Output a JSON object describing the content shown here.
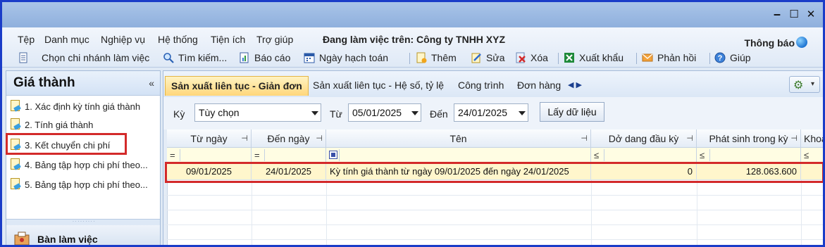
{
  "window": {
    "buttons": {
      "minimize": "‒",
      "maximize": "☐",
      "close": "✕"
    }
  },
  "menubar": {
    "items": [
      "Tệp",
      "Danh mục",
      "Nghiệp vụ",
      "Hệ thống",
      "Tiện ích",
      "Trợ giúp"
    ],
    "working_label": "Đang làm việc trên:  Công ty TNHH XYZ",
    "notification": "Thông báo"
  },
  "toolbar": {
    "branch": "Chọn chi nhánh làm việc",
    "search": "Tìm kiếm...",
    "report": "Báo cáo",
    "posting_date": "Ngày hạch toán",
    "add": "Thêm",
    "edit": "Sửa",
    "delete": "Xóa",
    "export": "Xuất khẩu",
    "feedback": "Phản hồi",
    "help": "Giúp"
  },
  "sidebar": {
    "title": "Giá thành",
    "collapse": "«",
    "items": [
      {
        "label": "1. Xác định kỳ tính giá thành"
      },
      {
        "label": "2. Tính giá thành"
      },
      {
        "label": "3. Kết chuyển chi phí"
      },
      {
        "label": "4. Bảng tập hợp chi phí theo..."
      },
      {
        "label": "5. Bảng tập hợp chi phí theo..."
      }
    ],
    "grip": "˙˙˙˙˙˙˙˙˙",
    "workspace": "Bàn làm việc"
  },
  "tabs": [
    {
      "label": "Sản xuất liên tục - Giản đơn",
      "active": true
    },
    {
      "label": "Sản xuất liên tục - Hệ số, tỷ lệ"
    },
    {
      "label": "Công trình"
    },
    {
      "label": "Đơn hàng"
    }
  ],
  "nav": "◀ ▶",
  "filter": {
    "period_label": "Kỳ",
    "period_value": "Tùy chọn",
    "from_label": "Từ",
    "from_value": "05/01/2025",
    "to_label": "Đến",
    "to_value": "24/01/2025",
    "get_data": "Lấy dữ liệu"
  },
  "grid": {
    "columns": [
      "Từ ngày",
      "Đến ngày",
      "Tên",
      "Dở dang đầu kỳ",
      "Phát sinh trong kỳ",
      "Khoả"
    ],
    "filter_ops": [
      "=",
      "=",
      "",
      "≤",
      "≤",
      "≤"
    ],
    "rows": [
      {
        "from": "09/01/2025",
        "to": "24/01/2025",
        "name": "Kỳ tính giá thành từ ngày 09/01/2025 đến ngày 24/01/2025",
        "opening_wip": "0",
        "incurred": "128.063.600",
        "extra": ""
      }
    ]
  }
}
